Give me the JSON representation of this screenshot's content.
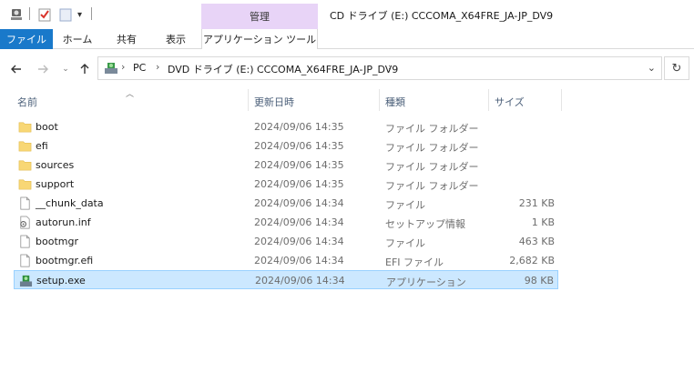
{
  "window": {
    "title": "CD ドライブ (E:) CCCOMA_X64FRE_JA-JP_DV9",
    "context_tab_group": "管理"
  },
  "ribbon": {
    "tabs": [
      "ファイル",
      "ホーム",
      "共有",
      "表示"
    ],
    "context_tab": "アプリケーション ツール"
  },
  "address": {
    "crumbs": [
      "PC",
      "DVD ドライブ (E:) CCCOMA_X64FRE_JA-JP_DV9"
    ]
  },
  "columns": {
    "name": "名前",
    "date": "更新日時",
    "type": "種類",
    "size": "サイズ"
  },
  "files": [
    {
      "name": "boot",
      "date": "2024/09/06 14:35",
      "type": "ファイル フォルダー",
      "size": "",
      "icon": "folder-icon"
    },
    {
      "name": "efi",
      "date": "2024/09/06 14:35",
      "type": "ファイル フォルダー",
      "size": "",
      "icon": "folder-icon"
    },
    {
      "name": "sources",
      "date": "2024/09/06 14:35",
      "type": "ファイル フォルダー",
      "size": "",
      "icon": "folder-icon"
    },
    {
      "name": "support",
      "date": "2024/09/06 14:35",
      "type": "ファイル フォルダー",
      "size": "",
      "icon": "folder-icon"
    },
    {
      "name": "__chunk_data",
      "date": "2024/09/06 14:34",
      "type": "ファイル",
      "size": "231 KB",
      "icon": "file-icon"
    },
    {
      "name": "autorun.inf",
      "date": "2024/09/06 14:34",
      "type": "セットアップ情報",
      "size": "1 KB",
      "icon": "settings-file-icon"
    },
    {
      "name": "bootmgr",
      "date": "2024/09/06 14:34",
      "type": "ファイル",
      "size": "463 KB",
      "icon": "file-icon"
    },
    {
      "name": "bootmgr.efi",
      "date": "2024/09/06 14:34",
      "type": "EFI ファイル",
      "size": "2,682 KB",
      "icon": "file-icon"
    },
    {
      "name": "setup.exe",
      "date": "2024/09/06 14:34",
      "type": "アプリケーション",
      "size": "98 KB",
      "icon": "setup-app-icon",
      "selected": true
    }
  ],
  "colors": {
    "file_tab": "#1979ca",
    "manage_tab": "#e8d4f7",
    "selection": "#cce8ff",
    "selection_border": "#99d1ff",
    "folder": "#f8d775"
  }
}
